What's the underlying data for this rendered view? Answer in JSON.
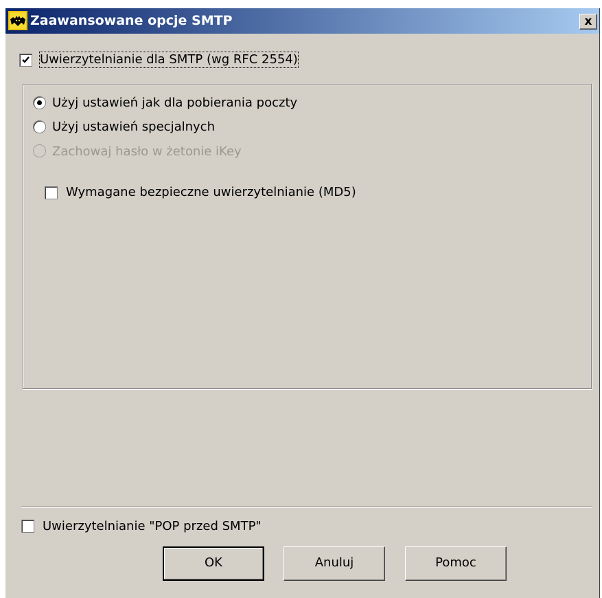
{
  "window": {
    "title": "Zaawansowane opcje SMTP",
    "close_label": "x"
  },
  "smtp_auth": {
    "label": "Uwierzytelnianie dla SMTP (wg RFC 2554)",
    "checked": true
  },
  "options": {
    "use_receive_settings": {
      "label": "Użyj ustawień jak dla pobierania poczty",
      "selected": true
    },
    "use_special_settings": {
      "label": "Użyj ustawień specjalnych",
      "selected": false
    },
    "keep_password_ikey": {
      "label": "Zachowaj hasło w żetonie iKey",
      "enabled": false
    },
    "secure_auth_md5": {
      "label": "Wymagane bezpieczne uwierzytelnianie (MD5)",
      "checked": false
    }
  },
  "pop_before_smtp": {
    "label": "Uwierzytelnianie \"POP przed SMTP\"",
    "checked": false
  },
  "buttons": {
    "ok": "OK",
    "cancel": "Anuluj",
    "help": "Pomoc"
  },
  "colors": {
    "titlebar_start": "#0a246a",
    "titlebar_end": "#a6caf0",
    "face": "#d4d0c8"
  }
}
